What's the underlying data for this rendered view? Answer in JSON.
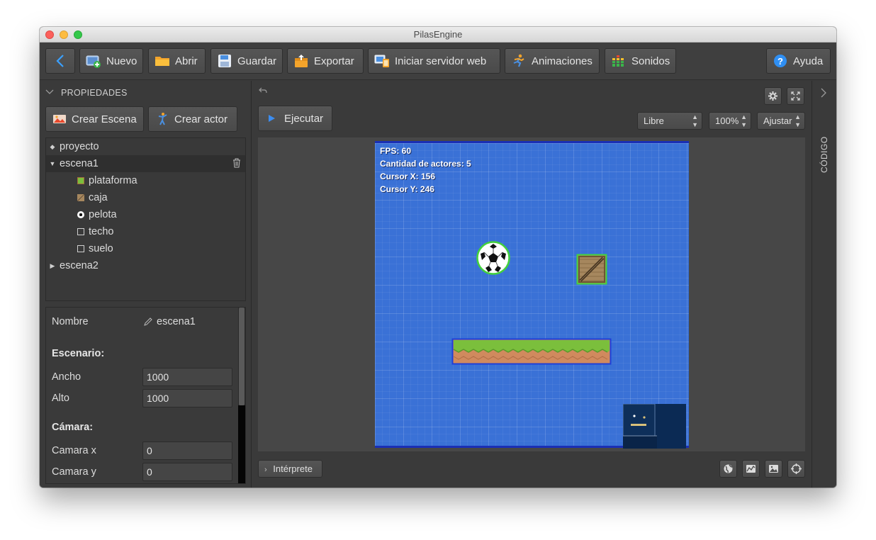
{
  "window": {
    "title": "PilasEngine"
  },
  "toolbar": {
    "buttons": [
      {
        "label": "Nuevo",
        "icon": "new-project-icon"
      },
      {
        "label": "Abrir",
        "icon": "folder-icon"
      },
      {
        "label": "Guardar",
        "icon": "floppy-disk-icon"
      },
      {
        "label": "Exportar",
        "icon": "export-box-icon"
      },
      {
        "label": "Iniciar servidor web",
        "icon": "devices-icon"
      },
      {
        "label": "Animaciones",
        "icon": "running-figure-icon"
      },
      {
        "label": "Sonidos",
        "icon": "equalizer-icon"
      }
    ],
    "help_label": "Ayuda"
  },
  "left_panel": {
    "header": "PROPIEDADES",
    "create_scene": "Crear Escena",
    "create_actor": "Crear actor",
    "tree": {
      "project": "proyecto",
      "scene1": "escena1",
      "actors": [
        "plataforma",
        "caja",
        "pelota",
        "techo",
        "suelo"
      ],
      "scene2": "escena2"
    },
    "properties": {
      "name_label": "Nombre",
      "name_value": "escena1",
      "scenario_title": "Escenario:",
      "width_label": "Ancho",
      "width_value": "1000",
      "height_label": "Alto",
      "height_value": "1000",
      "camera_title": "Cámara:",
      "camx_label": "Camara x",
      "camx_value": "0",
      "camy_label": "Camara y",
      "camy_value": "0"
    }
  },
  "center": {
    "run_label": "Ejecutar",
    "mode_select": "Libre",
    "zoom_select": "100%",
    "fit_select": "Ajustar",
    "hud": {
      "fps": "FPS: 60",
      "actors": "Cantidad de actores: 5",
      "cursor_x": "Cursor X: 156",
      "cursor_y": "Cursor Y: 246"
    },
    "interpreter_label": "Intérprete"
  },
  "right_panel": {
    "label": "CÓDIGO"
  },
  "colors": {
    "stage_blue": "#3a71d6",
    "stage_border": "#1a2fb5",
    "selection_green": "#44d13c",
    "platform_border": "#1f3fd8",
    "help_blue": "#2f8ff3",
    "run_blue": "#3c8df0"
  }
}
